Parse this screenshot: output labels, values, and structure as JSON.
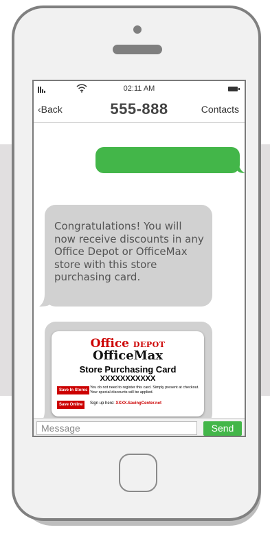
{
  "status": {
    "time": "02:11 AM"
  },
  "nav": {
    "back": "‹Back",
    "title": "555-888",
    "contacts": "Contacts"
  },
  "messages": {
    "received_text": "Congratulations! You will now receive discounts in any Office Depot or OfficeMax store with this store purchasing card."
  },
  "card": {
    "brand_office": "Office ",
    "brand_depot": "DEPOT",
    "brand_max": "OfficeMax",
    "title": "Store Purchasing Card",
    "number": "XXXXXXXXXXX",
    "save_in_stores": "Save In Stores",
    "in_store_note": "You do not need to register this card. Simply present at checkout. Your special discounts will be applied.",
    "save_online": "Save Online",
    "signup_prefix": "Sign up here: ",
    "signup_url": "XXXX.SavingCenter.net"
  },
  "composer": {
    "placeholder": "Message",
    "send": "Send"
  },
  "colors": {
    "green": "#43b649",
    "bubble_gray": "#d1d1d1",
    "brand_red": "#cc0000"
  },
  "icons": [
    "signal-icon",
    "wifi-icon",
    "battery-icon",
    "camera-icon",
    "speaker-icon",
    "home-button"
  ]
}
